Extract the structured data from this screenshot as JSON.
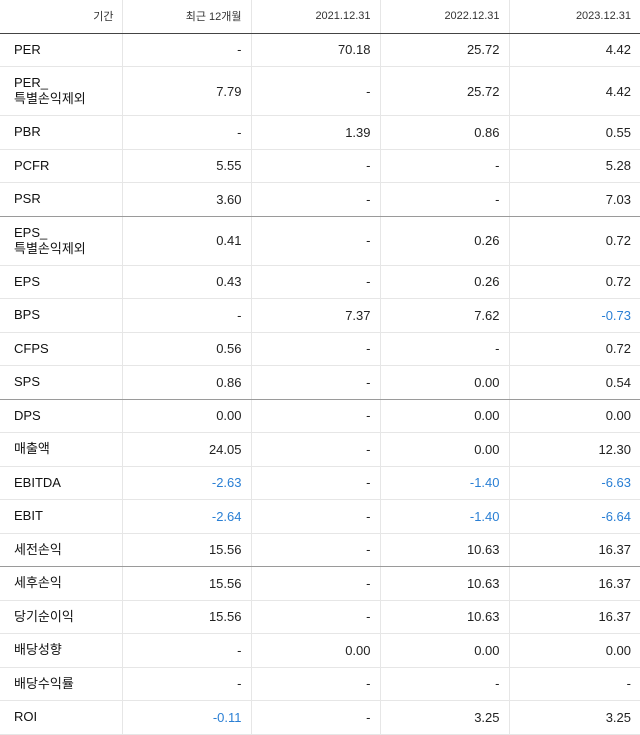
{
  "header": [
    "기간",
    "최근 12개월",
    "2021.12.31",
    "2022.12.31",
    "2023.12.31"
  ],
  "rows": [
    {
      "label": "PER",
      "values": [
        "-",
        "70.18",
        "25.72",
        "4.42"
      ]
    },
    {
      "label": "PER_\n특별손익제외",
      "values": [
        "7.79",
        "-",
        "25.72",
        "4.42"
      ]
    },
    {
      "label": "PBR",
      "values": [
        "-",
        "1.39",
        "0.86",
        "0.55"
      ]
    },
    {
      "label": "PCFR",
      "values": [
        "5.55",
        "-",
        "-",
        "5.28"
      ]
    },
    {
      "label": "PSR",
      "values": [
        "3.60",
        "-",
        "-",
        "7.03"
      ]
    },
    {
      "label": "EPS_\n특별손익제외",
      "values": [
        "0.41",
        "-",
        "0.26",
        "0.72"
      ]
    },
    {
      "label": "EPS",
      "values": [
        "0.43",
        "-",
        "0.26",
        "0.72"
      ]
    },
    {
      "label": "BPS",
      "values": [
        "-",
        "7.37",
        "7.62",
        "-0.73"
      ]
    },
    {
      "label": "CFPS",
      "values": [
        "0.56",
        "-",
        "-",
        "0.72"
      ]
    },
    {
      "label": "SPS",
      "values": [
        "0.86",
        "-",
        "0.00",
        "0.54"
      ]
    },
    {
      "label": "DPS",
      "values": [
        "0.00",
        "-",
        "0.00",
        "0.00"
      ]
    },
    {
      "label": "매출액",
      "values": [
        "24.05",
        "-",
        "0.00",
        "12.30"
      ]
    },
    {
      "label": "EBITDA",
      "values": [
        "-2.63",
        "-",
        "-1.40",
        "-6.63"
      ]
    },
    {
      "label": "EBIT",
      "values": [
        "-2.64",
        "-",
        "-1.40",
        "-6.64"
      ]
    },
    {
      "label": "세전손익",
      "values": [
        "15.56",
        "-",
        "10.63",
        "16.37"
      ]
    },
    {
      "label": "세후손익",
      "values": [
        "15.56",
        "-",
        "10.63",
        "16.37"
      ]
    },
    {
      "label": "당기순이익",
      "values": [
        "15.56",
        "-",
        "10.63",
        "16.37"
      ]
    },
    {
      "label": "배당성향",
      "values": [
        "-",
        "0.00",
        "0.00",
        "0.00"
      ]
    },
    {
      "label": "배당수익률",
      "values": [
        "-",
        "-",
        "-",
        "-"
      ]
    },
    {
      "label": "ROI",
      "values": [
        "-0.11",
        "-",
        "3.25",
        "3.25"
      ]
    }
  ],
  "colors": {
    "negative": "#2a7fd4"
  }
}
